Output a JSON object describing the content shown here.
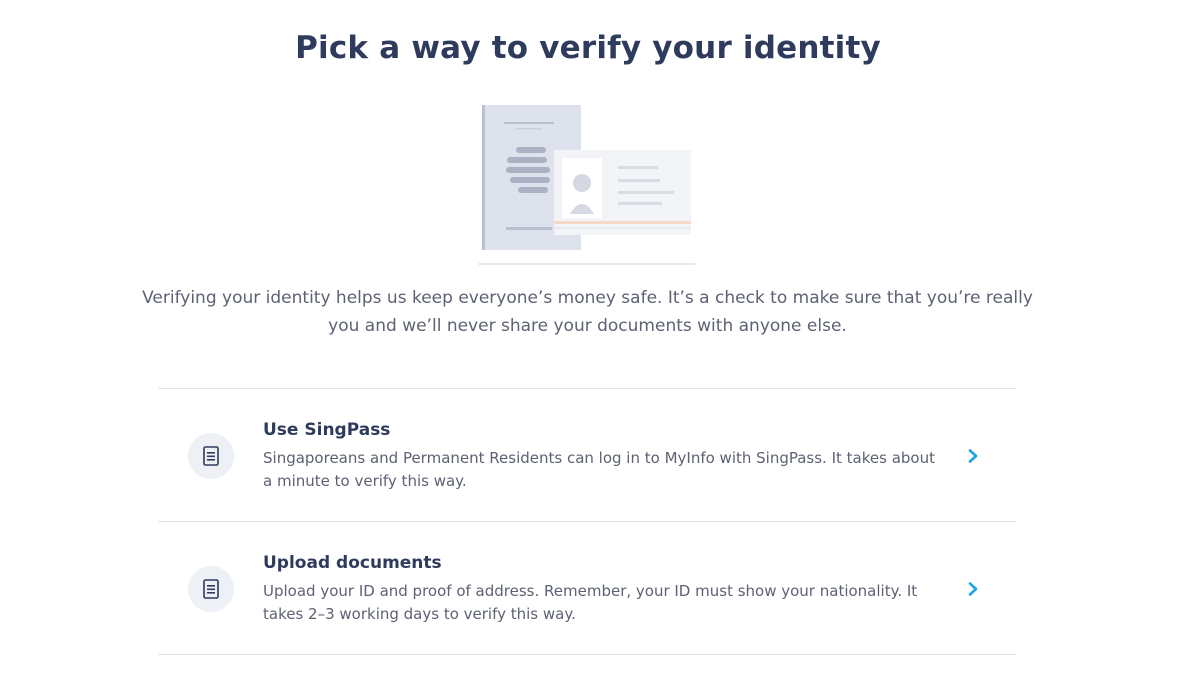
{
  "page": {
    "title": "Pick a way to verify your identity",
    "intro": "Verifying your identity helps us keep everyone’s money safe. It’s a check to make sure that you’re really you and we’ll never share your documents with anyone else."
  },
  "options": [
    {
      "title": "Use SingPass",
      "description": "Singaporeans and Permanent Residents can log in to MyInfo with SingPass. It takes about a minute to verify this way.",
      "icon": "document-icon"
    },
    {
      "title": "Upload documents",
      "description": "Upload your ID and proof of address. Remember, your ID must show your nationality. It takes 2–3 working days to verify this way.",
      "icon": "document-icon"
    }
  ],
  "colors": {
    "heading": "#2e3b5c",
    "body_text": "#5d6273",
    "accent_chevron": "#1ea3e6",
    "icon_circle": "#edf0f5",
    "divider": "#e3e5ea"
  }
}
